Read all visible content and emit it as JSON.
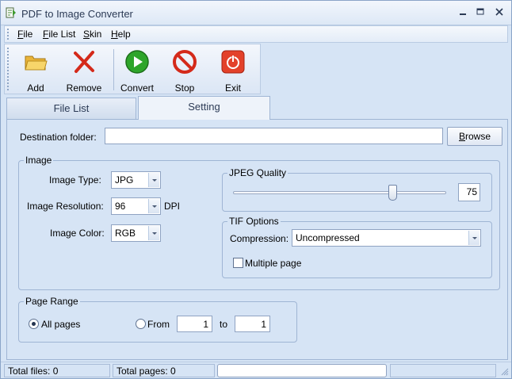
{
  "window": {
    "title": "PDF to Image Converter",
    "minimize_icon": "minimize-icon",
    "maximize_icon": "maximize-icon",
    "close_icon": "close-icon"
  },
  "menu": {
    "items": [
      {
        "underline": "F",
        "rest": "ile"
      },
      {
        "underline": "F",
        "rest": "ile List"
      },
      {
        "underline": "S",
        "rest": "kin"
      },
      {
        "underline": "H",
        "rest": "elp"
      }
    ]
  },
  "toolbar": {
    "add": "Add",
    "remove": "Remove",
    "convert": "Convert",
    "stop": "Stop",
    "exit": "Exit"
  },
  "tabs": {
    "file_list": "File List",
    "setting": "Setting",
    "active": "Setting"
  },
  "destination": {
    "label": "Destination folder:",
    "value": "",
    "browse_underline": "B",
    "browse_rest": "rowse"
  },
  "image": {
    "group_title": "Image",
    "type_label": "Image Type:",
    "type_value": "JPG",
    "resolution_label": "Image Resolution:",
    "resolution_value": "96",
    "resolution_unit": "DPI",
    "color_label": "Image Color:",
    "color_value": "RGB"
  },
  "jpeg": {
    "group_title": "JPEG Quality",
    "quality": 75,
    "quality_text": "75"
  },
  "tif": {
    "group_title": "TIF Options",
    "compression_label": "Compression:",
    "compression_value": "Uncompressed",
    "multiple_page_label": "Multiple page",
    "multiple_page_checked": false
  },
  "page_range": {
    "group_title": "Page Range",
    "all_pages_label": "All pages",
    "from_label": "From",
    "to_label": "to",
    "from_value": "1",
    "to_value": "1",
    "selected": "All pages"
  },
  "status": {
    "total_files": "Total files: 0",
    "total_pages": "Total pages: 0",
    "progress": 0
  },
  "colors": {
    "window_bg": "#d6e4f5",
    "accent": "#9fb5d4"
  }
}
